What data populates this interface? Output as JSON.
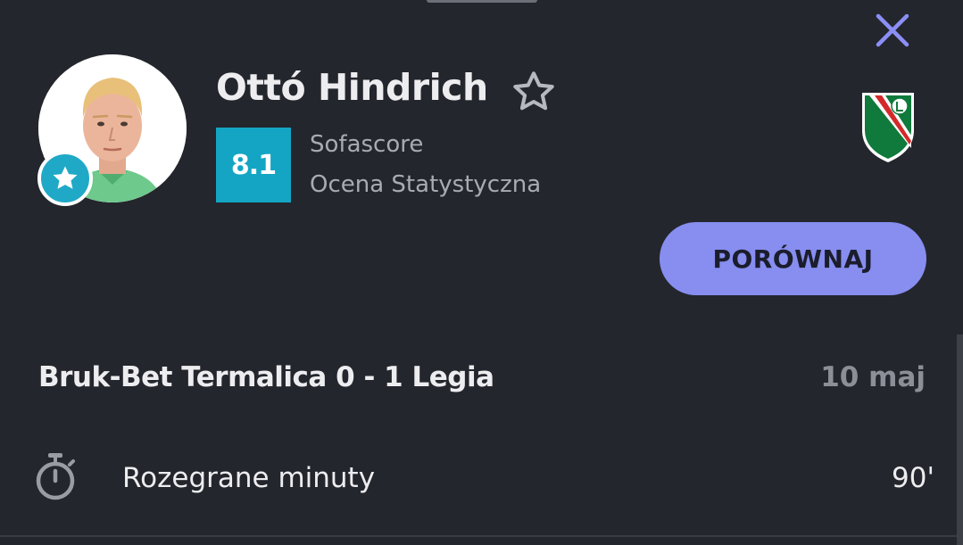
{
  "player": {
    "name": "Ottó Hindrich",
    "rating": "8.1",
    "rating_source": "Sofascore",
    "rating_type": "Ocena Statystyczna"
  },
  "actions": {
    "compare_label": "PORÓWNAJ"
  },
  "match": {
    "title": "Bruk-Bet Termalica 0 - 1 Legia",
    "date": "10 maj"
  },
  "stats": [
    {
      "icon": "stopwatch-icon",
      "label": "Rozegrane minuty",
      "value": "90'"
    }
  ],
  "icons": {
    "close": "close-icon",
    "favorite": "star-outline-icon",
    "avatar_badge": "star-icon",
    "club": "legia-crest-icon"
  },
  "colors": {
    "background": "#24262d",
    "rating_bg": "#14a5c4",
    "accent": "#878ef0",
    "close": "#8b8ff5",
    "muted_text": "#a9abb3"
  }
}
